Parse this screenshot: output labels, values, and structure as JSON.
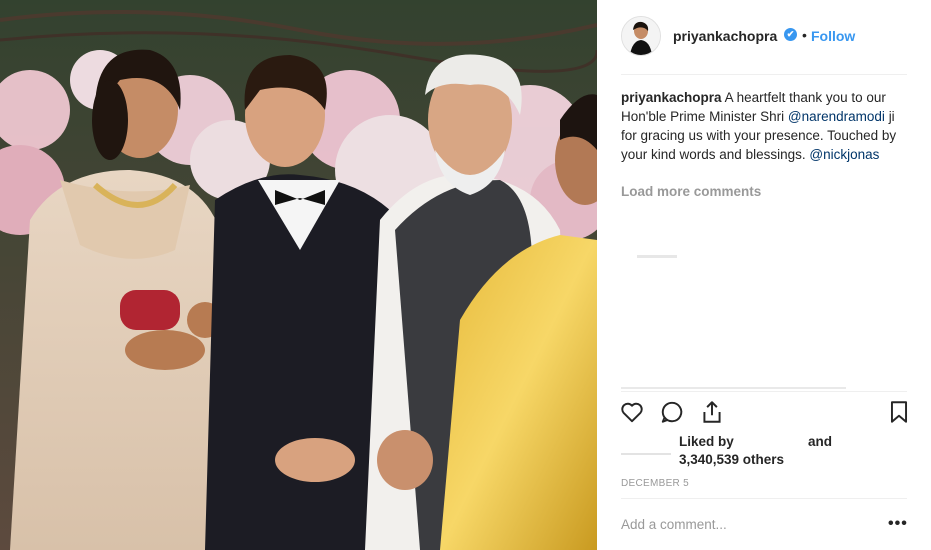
{
  "post": {
    "username": "priyankachopra",
    "verified_mark": "✔",
    "dot": "•",
    "follow_label": "Follow",
    "caption": {
      "username": "priyankachopra",
      "text_1": "A heartfelt thank you to our Hon'ble Prime Minister Shri",
      "mention_1": "@narendramodi",
      "text_2": "ji for gracing us with your presence. Touched by your kind words and blessings.",
      "mention_2": "@nickjonas"
    },
    "load_more": "Load more comments",
    "actions": {
      "like_icon": "heart-icon",
      "comment_icon": "comment-icon",
      "share_icon": "share-icon",
      "save_icon": "bookmark-icon"
    },
    "likes": {
      "liked_by": "Liked by",
      "and": "and",
      "count_text": "3,340,539 others"
    },
    "date": "DECEMBER 5",
    "add_comment_placeholder": "Add a comment...",
    "more_options": "•••"
  },
  "colors": {
    "accent": "#3897f0",
    "mention": "#003569",
    "muted": "#999999",
    "text": "#262626"
  }
}
